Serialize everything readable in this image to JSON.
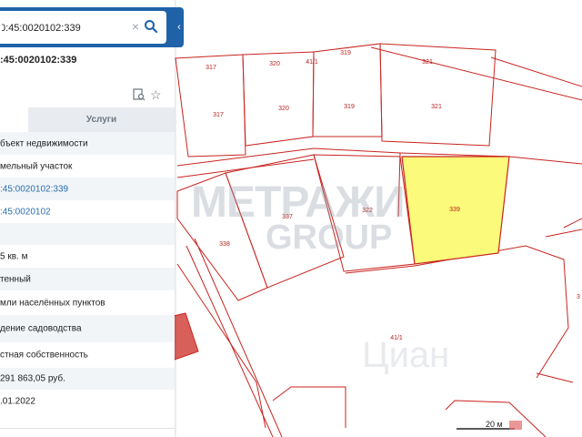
{
  "search": {
    "value": "0:45:0020102:339"
  },
  "panel": {
    "title": ":45:0020102:339",
    "tab_services": "Услуги",
    "rows": [
      "бъект недвижимости",
      "мельный участок",
      ":45:0020102:339",
      ":45:0020102",
      "",
      "5 кв. м",
      "тенный",
      "мли населённых пунктов",
      "дение садоводства",
      "стная собственность",
      "291 863,05 руб.",
      ".01.2022"
    ]
  },
  "map": {
    "parcels": [
      "317",
      "317",
      "320",
      "320",
      "41/1",
      "319",
      "319",
      "321",
      "321",
      "337",
      "338",
      "322",
      "339",
      "41/1",
      "3"
    ],
    "highlight_color": "#fbfa7a",
    "boundary_color": "#c8241f",
    "scale_label": "20 м",
    "watermark_top": "МЕТРАЖИ",
    "watermark_bottom": "GROUP",
    "watermark_corner": "Циан"
  }
}
